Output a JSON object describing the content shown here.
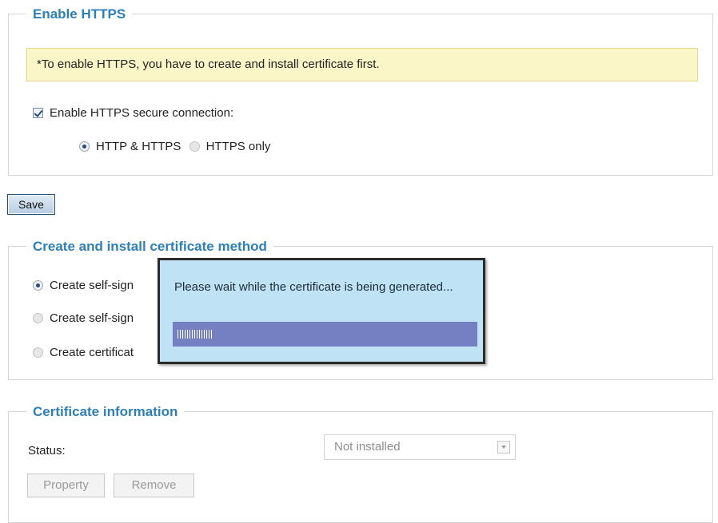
{
  "https_section": {
    "legend": "Enable HTTPS",
    "note": "*To enable HTTPS, you have to create and install certificate first.",
    "enable_checkbox": {
      "label": "Enable HTTPS secure connection:",
      "checked": true
    },
    "mode_options": [
      {
        "label": "HTTP & HTTPS",
        "selected": true
      },
      {
        "label": "HTTPS only",
        "selected": false
      }
    ]
  },
  "save_button": {
    "label": "Save"
  },
  "method_section": {
    "legend": "Create and install certificate method",
    "options": [
      {
        "label": "Create self-sign",
        "selected": true
      },
      {
        "label": "Create self-sign",
        "selected": false
      },
      {
        "label": "Create certificat",
        "selected": false
      }
    ]
  },
  "progress_popup": {
    "message": "Please wait while the certificate is being generated...",
    "progress": 0.12
  },
  "certificate_info": {
    "legend": "Certificate information",
    "status_label": "Status:",
    "status_value": "Not installed",
    "property_button": "Property",
    "remove_button": "Remove"
  }
}
